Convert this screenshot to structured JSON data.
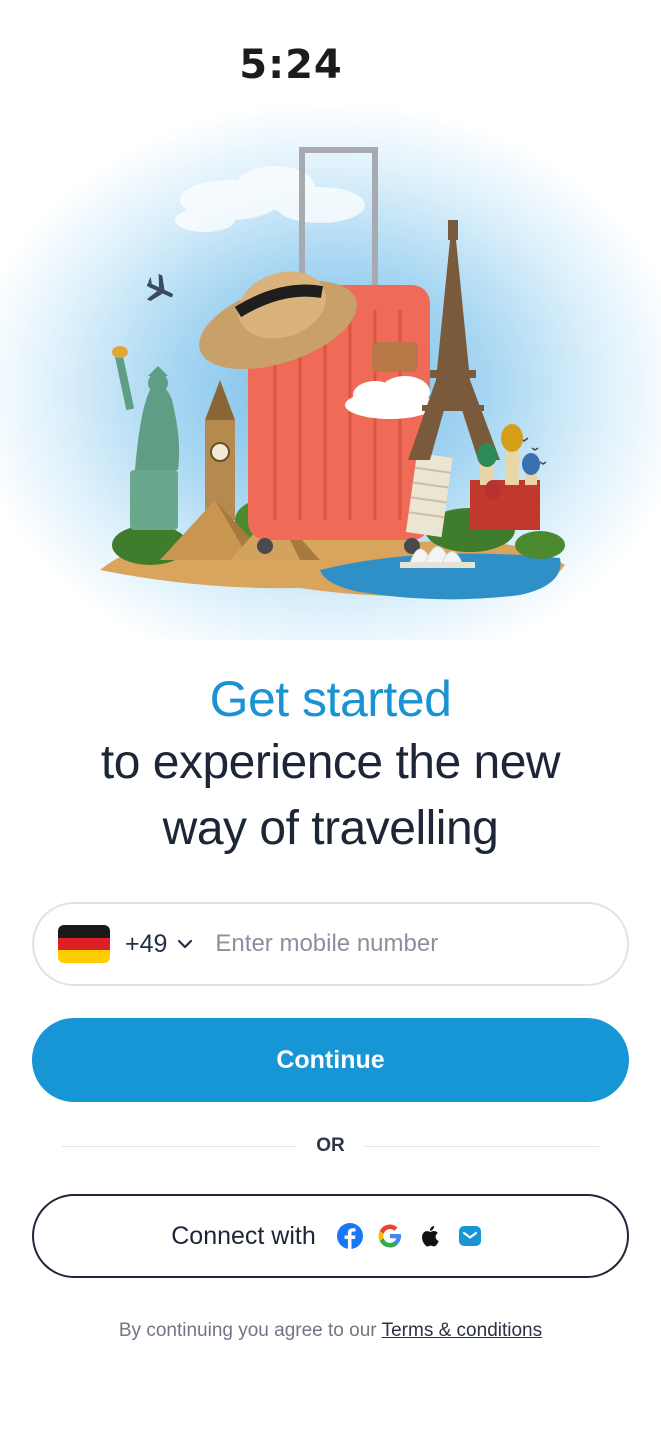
{
  "status_bar": {
    "time": "5:24"
  },
  "headline": {
    "accent": "Get started",
    "line1": "to experience the new",
    "line2": "way of travelling"
  },
  "phone": {
    "country_code": "+49",
    "placeholder": "Enter mobile number",
    "flag_colors": [
      "#1a1a1a",
      "#dd1f26",
      "#ffce00"
    ]
  },
  "continue_label": "Continue",
  "divider_label": "OR",
  "connect": {
    "label": "Connect with",
    "providers": [
      "facebook-icon",
      "google-icon",
      "apple-icon",
      "email-icon"
    ]
  },
  "terms": {
    "prefix": "By continuing you agree to our",
    "link": "Terms & conditions"
  },
  "colors": {
    "primary": "#1796d6",
    "accent_text": "#1a93d2",
    "dark_text": "#1c2637"
  }
}
